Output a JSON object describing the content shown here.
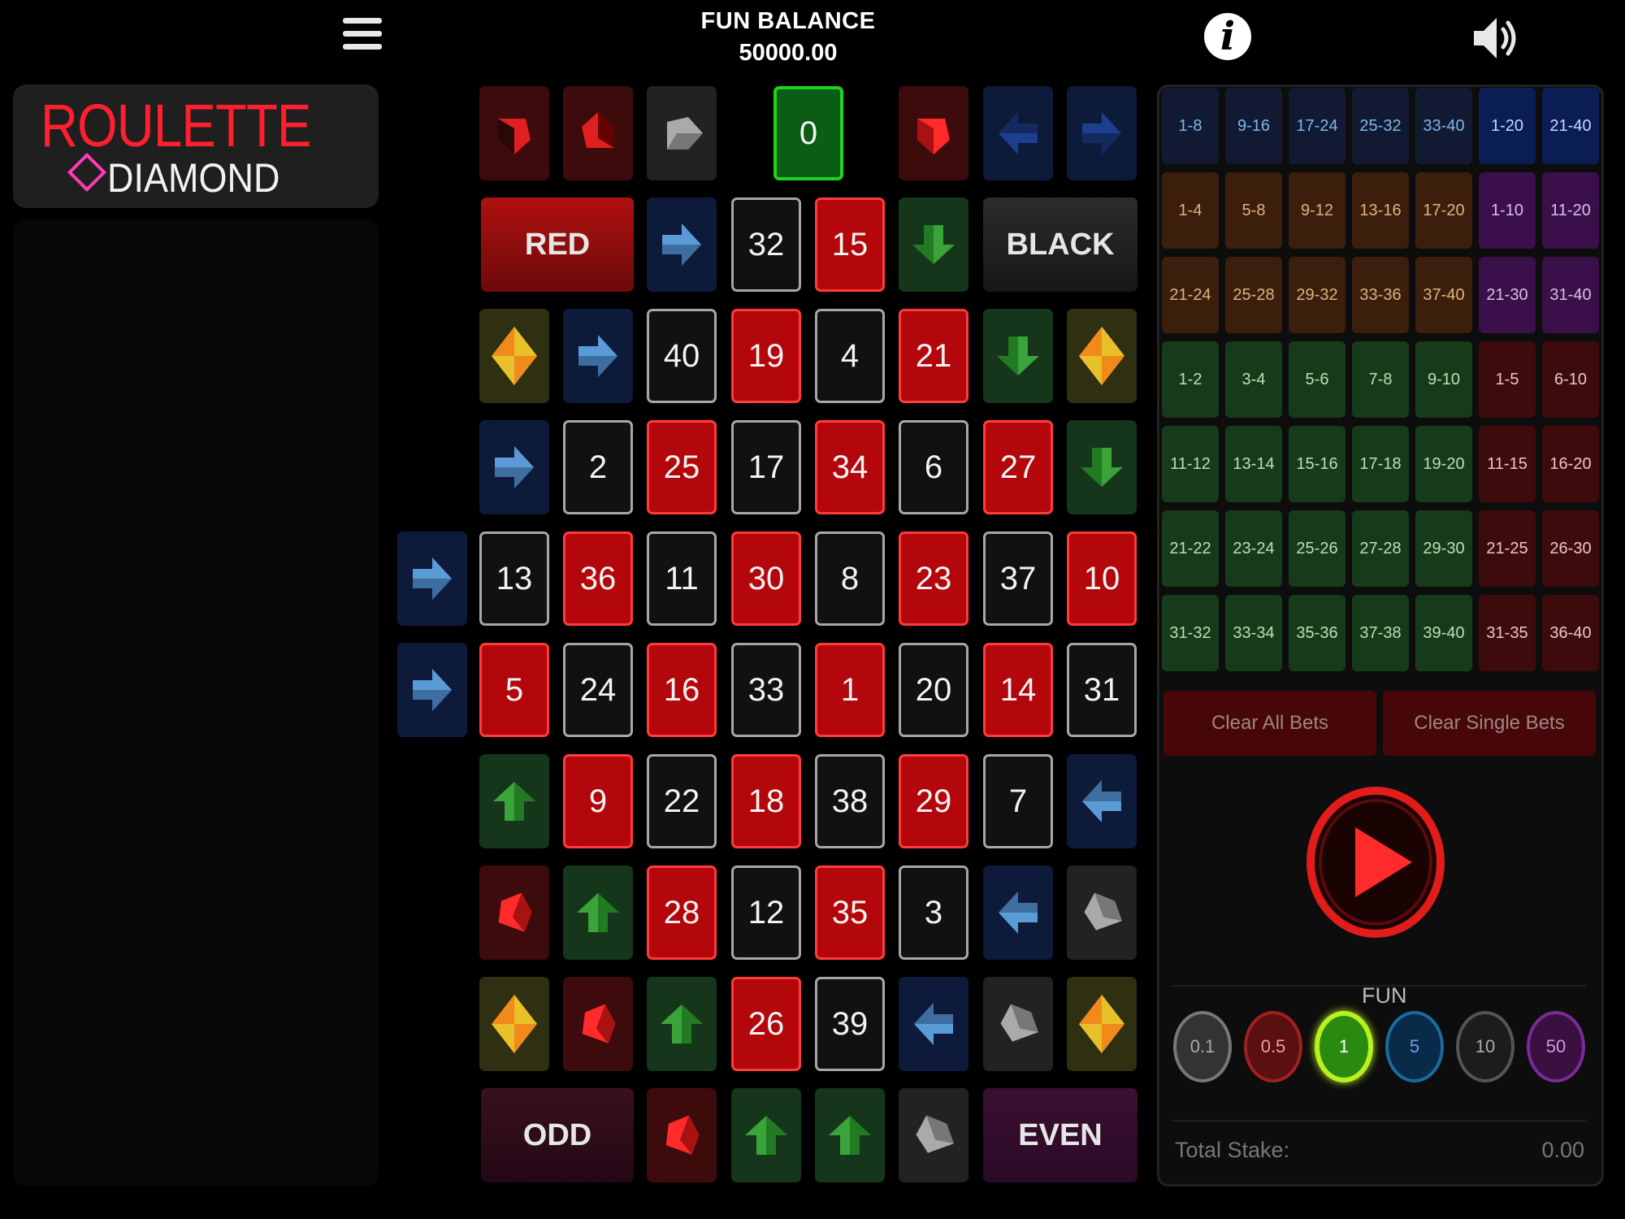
{
  "header": {
    "balance_label": "FUN BALANCE",
    "balance_value": "50000.00"
  },
  "logo": {
    "line1": "ROULETTE",
    "line2": "DIAMOND"
  },
  "board": {
    "zero": "0",
    "red_label": "RED",
    "black_label": "BLACK",
    "odd_label": "ODD",
    "even_label": "EVEN",
    "numbers": [
      {
        "n": "32",
        "c": "black"
      },
      {
        "n": "15",
        "c": "red"
      },
      {
        "n": "40",
        "c": "black"
      },
      {
        "n": "19",
        "c": "red"
      },
      {
        "n": "4",
        "c": "black"
      },
      {
        "n": "21",
        "c": "red"
      },
      {
        "n": "2",
        "c": "black"
      },
      {
        "n": "25",
        "c": "red"
      },
      {
        "n": "17",
        "c": "black"
      },
      {
        "n": "34",
        "c": "red"
      },
      {
        "n": "6",
        "c": "black"
      },
      {
        "n": "27",
        "c": "red"
      },
      {
        "n": "13",
        "c": "black"
      },
      {
        "n": "36",
        "c": "red"
      },
      {
        "n": "11",
        "c": "black"
      },
      {
        "n": "30",
        "c": "red"
      },
      {
        "n": "8",
        "c": "black"
      },
      {
        "n": "23",
        "c": "red"
      },
      {
        "n": "37",
        "c": "black"
      },
      {
        "n": "10",
        "c": "red"
      },
      {
        "n": "5",
        "c": "red"
      },
      {
        "n": "24",
        "c": "black"
      },
      {
        "n": "16",
        "c": "red"
      },
      {
        "n": "33",
        "c": "black"
      },
      {
        "n": "1",
        "c": "red"
      },
      {
        "n": "20",
        "c": "black"
      },
      {
        "n": "14",
        "c": "red"
      },
      {
        "n": "31",
        "c": "black"
      },
      {
        "n": "9",
        "c": "red"
      },
      {
        "n": "22",
        "c": "black"
      },
      {
        "n": "18",
        "c": "red"
      },
      {
        "n": "38",
        "c": "black"
      },
      {
        "n": "29",
        "c": "red"
      },
      {
        "n": "7",
        "c": "black"
      },
      {
        "n": "28",
        "c": "red"
      },
      {
        "n": "12",
        "c": "black"
      },
      {
        "n": "35",
        "c": "red"
      },
      {
        "n": "3",
        "c": "black"
      },
      {
        "n": "26",
        "c": "red"
      },
      {
        "n": "39",
        "c": "black"
      }
    ]
  },
  "bets": {
    "rows": [
      [
        "1-8",
        "9-16",
        "17-24",
        "25-32",
        "33-40",
        "1-20",
        "21-40"
      ],
      [
        "1-4",
        "5-8",
        "9-12",
        "13-16",
        "17-20",
        "1-10",
        "11-20"
      ],
      [
        "21-24",
        "25-28",
        "29-32",
        "33-36",
        "37-40",
        "21-30",
        "31-40"
      ],
      [
        "1-2",
        "3-4",
        "5-6",
        "7-8",
        "9-10",
        "1-5",
        "6-10"
      ],
      [
        "11-12",
        "13-14",
        "15-16",
        "17-18",
        "19-20",
        "11-15",
        "16-20"
      ],
      [
        "21-22",
        "23-24",
        "25-26",
        "27-28",
        "29-30",
        "21-25",
        "26-30"
      ],
      [
        "31-32",
        "33-34",
        "35-36",
        "37-38",
        "39-40",
        "31-35",
        "36-40"
      ]
    ],
    "clear_all": "Clear All Bets",
    "clear_single": "Clear Single Bets"
  },
  "chips": {
    "label": "FUN",
    "values": [
      "0.1",
      "0.5",
      "1",
      "5",
      "10",
      "50"
    ],
    "selected": "1"
  },
  "stake": {
    "label": "Total Stake:",
    "value": "0.00"
  },
  "icons": [
    "menu-icon",
    "info-icon",
    "sound-icon",
    "play-icon"
  ]
}
